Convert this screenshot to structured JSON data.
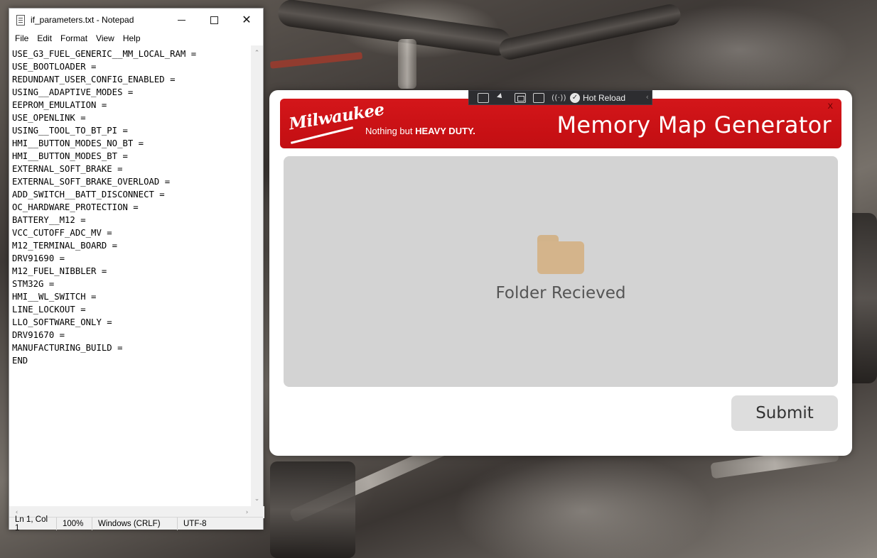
{
  "notepad": {
    "title": "if_parameters.txt - Notepad",
    "window_controls": {
      "minimize": "",
      "maximize": "",
      "close": "✕"
    },
    "menu": [
      "File",
      "Edit",
      "Format",
      "View",
      "Help"
    ],
    "content": "USE_G3_FUEL_GENERIC__MM_LOCAL_RAM =\nUSE_BOOTLOADER =\nREDUNDANT_USER_CONFIG_ENABLED =\nUSING__ADAPTIVE_MODES =\nEEPROM_EMULATION =\nUSE_OPENLINK =\nUSING__TOOL_TO_BT_PI =\nHMI__BUTTON_MODES_NO_BT =\nHMI__BUTTON_MODES_BT =\nEXTERNAL_SOFT_BRAKE =\nEXTERNAL_SOFT_BRAKE_OVERLOAD =\nADD_SWITCH__BATT_DISCONNECT =\nOC_HARDWARE_PROTECTION =\nBATTERY__M12 =\nVCC_CUTOFF_ADC_MV =\nM12_TERMINAL_BOARD =\nDRV91690 =\nM12_FUEL_NIBBLER =\nSTM32G =\nHMI__WL_SWITCH =\nLINE_LOCKOUT =\nLLO_SOFTWARE_ONLY =\nDRV91670 =\nMANUFACTURING_BUILD =\nEND",
    "status": {
      "position": "Ln 1, Col 1",
      "zoom": "100%",
      "line_endings": "Windows (CRLF)",
      "encoding": "UTF-8"
    },
    "scroll_arrows": {
      "up": "⌃",
      "down": "⌄",
      "left": "‹",
      "right": "›"
    }
  },
  "app": {
    "brand_wordmark": "Milwaukee",
    "tagline_prefix": "Nothing but ",
    "tagline_bold": "HEAVY DUTY.",
    "title": "Memory Map Generator",
    "close_label": "X",
    "dropzone_status": "Folder Recieved",
    "submit_label": "Submit",
    "colors": {
      "banner": "#c9131a",
      "dropzone": "#d3d3d3",
      "folder": "#d4b48b"
    }
  },
  "hot_reload_bar": {
    "label": "Hot Reload",
    "collapse_glyph": "‹",
    "icons": [
      "live-visual-tree-icon",
      "select-element-icon",
      "display-layout-adorners-icon",
      "track-focus-icon",
      "binding-failures-icon",
      "hot-reload-check-icon"
    ]
  }
}
